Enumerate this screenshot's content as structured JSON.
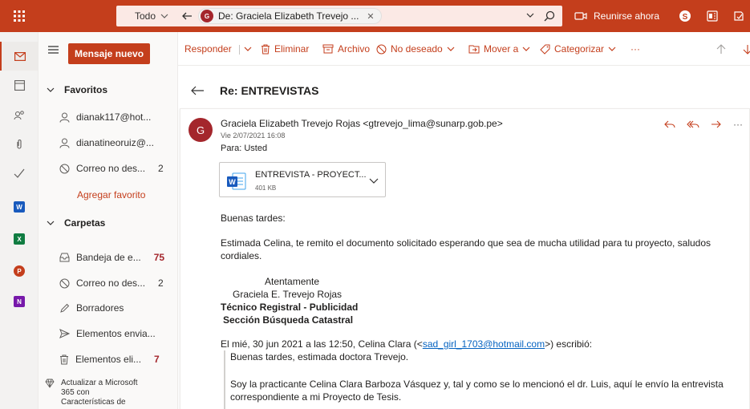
{
  "topbar": {
    "search_scope": "Todo",
    "search_chip": "De: Graciela Elizabeth Trevejo ...",
    "chip_initial": "G",
    "meet_now": "Reunirse ahora",
    "accent": "#c43e1c"
  },
  "folders": {
    "new_message": "Mensaje nuevo",
    "favorites_header": "Favoritos",
    "favorites": [
      {
        "label": "dianak117@hot...",
        "icon": "person-icon",
        "count": ""
      },
      {
        "label": "dianatineoruiz@...",
        "icon": "person-icon",
        "count": ""
      },
      {
        "label": "Correo no des...",
        "icon": "blocked-icon",
        "count": "2"
      }
    ],
    "add_favorite": "Agregar favorito",
    "folders_header": "Carpetas",
    "items": [
      {
        "label": "Bandeja de e...",
        "icon": "inbox-icon",
        "count": "75"
      },
      {
        "label": "Correo no des...",
        "icon": "blocked-icon",
        "count": "2"
      },
      {
        "label": "Borradores",
        "icon": "pencil-icon",
        "count": ""
      },
      {
        "label": "Elementos envia...",
        "icon": "send-icon",
        "count": ""
      },
      {
        "label": "Elementos eli...",
        "icon": "trash-icon",
        "count": "7"
      }
    ],
    "upgrade": "Actualizar a Microsoft 365 con Características de"
  },
  "commands": {
    "reply": "Responder",
    "delete": "Eliminar",
    "archive": "Archivo",
    "junk": "No deseado",
    "move": "Mover a",
    "categorize": "Categorizar",
    "more": "···"
  },
  "message": {
    "subject": "Re: ENTREVISTAS",
    "avatar_initial": "G",
    "from": "Graciela Elizabeth Trevejo Rojas <gtrevejo_lima@sunarp.gob.pe>",
    "date": "Vie 2/07/2021 16:08",
    "to": "Para:  Usted",
    "attachment_name": "ENTREVISTA - PROYECT...",
    "attachment_size": "401 KB",
    "greeting": "Buenas tardes:",
    "para1_line1": "Estimada Celina, te remito el documento solicitado esperando que sea de mucha utilidad para tu proyecto, saludos",
    "para1_line2": "cordiales.",
    "sig_line1": "Atentamente",
    "sig_line2": "Graciela E. Trevejo Rojas",
    "sig_line3": "Técnico Registral - Publicidad",
    "sig_line4": "Sección Búsqueda Catastral",
    "quote_intro_pre": "El mié, 30 jun 2021 a las 12:50, Celina Clara (<",
    "quote_email": "sad_girl_1703@hotmail.com",
    "quote_intro_post": ">) escribió:",
    "quote_line1": "Buenas tardes, estimada doctora Trevejo.",
    "quote_line2": "Soy la practicante Celina Clara Barboza Vásquez y, tal y como se lo mencionó el dr. Luis, aquí le envío la entrevista",
    "quote_line3": "correspondiente a mi Proyecto de Tesis."
  }
}
